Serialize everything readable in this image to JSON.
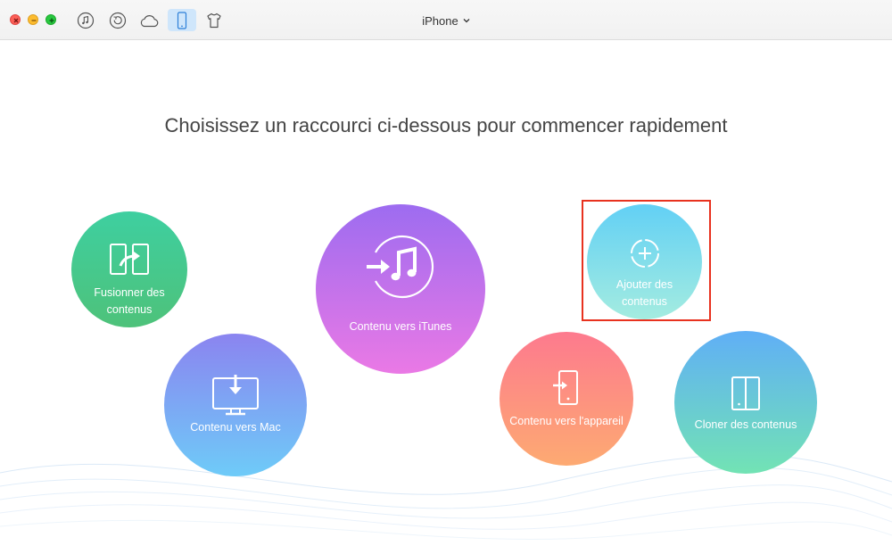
{
  "window": {
    "device_name": "iPhone",
    "toolbar_icons": [
      "music-icon",
      "restore-icon",
      "cloud-icon",
      "phone-icon",
      "shirt-icon"
    ],
    "active_icon": "phone-icon"
  },
  "main": {
    "headline": "Choisissez un raccourci ci-dessous pour commencer rapidement",
    "shortcuts": [
      {
        "label_lines": [
          "Fusionner des",
          "contenus"
        ],
        "icon": "merge-icon"
      },
      {
        "label_lines": [
          "Contenu vers Mac"
        ],
        "icon": "download-to-mac-icon"
      },
      {
        "label_lines": [
          "Contenu vers iTunes"
        ],
        "icon": "transfer-to-itunes-icon"
      },
      {
        "label_lines": [
          "Ajouter des",
          "contenus"
        ],
        "icon": "add-content-icon"
      },
      {
        "label_lines": [
          "Contenu vers l'appareil"
        ],
        "icon": "transfer-to-device-icon"
      },
      {
        "label_lines": [
          "Cloner des contenus"
        ],
        "icon": "clone-icon"
      }
    ],
    "highlighted_shortcut": "Ajouter des contenus"
  },
  "colors": {
    "highlight_border": "#e8321f",
    "merge": [
      "#3ecfa0",
      "#4ec27a"
    ],
    "mac": [
      "#8b84f0",
      "#6ecbf8"
    ],
    "itunes": [
      "#9d6cf0",
      "#ea79e5"
    ],
    "add": [
      "#62d0f5",
      "#a4ece0"
    ],
    "device": [
      "#fd7a8e",
      "#fdaa72"
    ],
    "clone": [
      "#60aff6",
      "#72e3b4"
    ]
  }
}
